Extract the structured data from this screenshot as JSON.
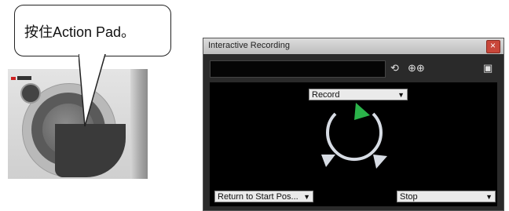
{
  "callout": {
    "text": "按住Action Pad。"
  },
  "window": {
    "title": "Interactive Recording",
    "close_label": "×",
    "toolbar": {
      "search_icon": "⟲",
      "zoom_icons": "⊕⊕",
      "maximize_icon": "▣"
    },
    "dropdowns": {
      "record": {
        "label": "Record",
        "arrow": "▼"
      },
      "return_to_start": {
        "label": "Return to Start Pos...",
        "arrow": "▼"
      },
      "stop": {
        "label": "Stop",
        "arrow": "▼"
      }
    }
  },
  "colors": {
    "green_arrow": "#2bb34a",
    "white_arrow": "#d7dce4"
  }
}
